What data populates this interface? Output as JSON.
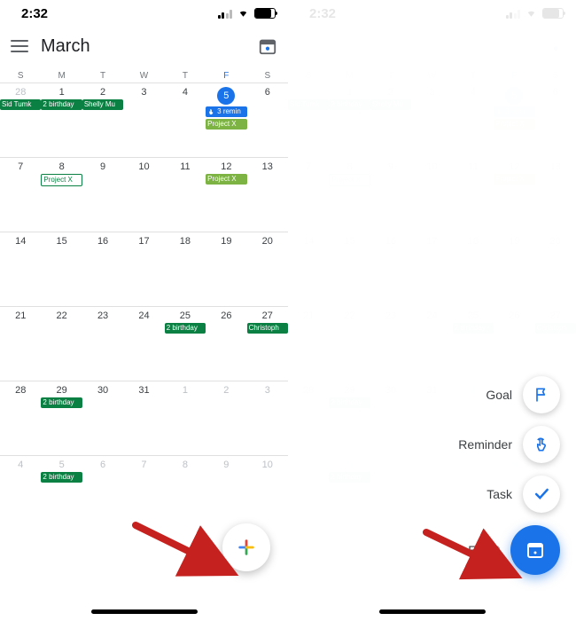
{
  "status": {
    "time": "2:32"
  },
  "header": {
    "month": "March"
  },
  "weekdays": [
    "S",
    "M",
    "T",
    "W",
    "T",
    "F",
    "S"
  ],
  "today_index": 5,
  "rows": [
    [
      {
        "n": "28",
        "dim": true,
        "chips": [
          {
            "t": "Sid Tumk",
            "s": "teal"
          }
        ]
      },
      {
        "n": "1",
        "chips": [
          {
            "t": "2 birthday",
            "s": "teal"
          }
        ]
      },
      {
        "n": "2",
        "chips": [
          {
            "t": "Shelly Mu",
            "s": "teal"
          }
        ]
      },
      {
        "n": "3"
      },
      {
        "n": "4"
      },
      {
        "n": "5",
        "today": true,
        "chips": [
          {
            "t": "3 remin",
            "s": "blue",
            "icon": true
          },
          {
            "t": "Project X",
            "s": "lime"
          }
        ]
      },
      {
        "n": "6"
      }
    ],
    [
      {
        "n": "7"
      },
      {
        "n": "8",
        "chips": [
          {
            "t": "Project X",
            "s": "outline"
          }
        ]
      },
      {
        "n": "9"
      },
      {
        "n": "10"
      },
      {
        "n": "11"
      },
      {
        "n": "12",
        "chips": [
          {
            "t": "Project X",
            "s": "lime"
          }
        ]
      },
      {
        "n": "13"
      }
    ],
    [
      {
        "n": "14"
      },
      {
        "n": "15"
      },
      {
        "n": "16"
      },
      {
        "n": "17"
      },
      {
        "n": "18"
      },
      {
        "n": "19"
      },
      {
        "n": "20"
      }
    ],
    [
      {
        "n": "21"
      },
      {
        "n": "22"
      },
      {
        "n": "23"
      },
      {
        "n": "24"
      },
      {
        "n": "25",
        "chips": [
          {
            "t": "2 birthday",
            "s": "teal"
          }
        ]
      },
      {
        "n": "26"
      },
      {
        "n": "27",
        "chips": [
          {
            "t": "Christoph",
            "s": "teal"
          }
        ]
      }
    ],
    [
      {
        "n": "28"
      },
      {
        "n": "29",
        "chips": [
          {
            "t": "2 birthday",
            "s": "teal"
          }
        ]
      },
      {
        "n": "30"
      },
      {
        "n": "31"
      },
      {
        "n": "1",
        "dim": true
      },
      {
        "n": "2",
        "dim": true
      },
      {
        "n": "3",
        "dim": true
      }
    ],
    [
      {
        "n": "4",
        "dim": true
      },
      {
        "n": "5",
        "dim": true,
        "chips": [
          {
            "t": "2 birthday",
            "s": "teal"
          }
        ]
      },
      {
        "n": "6",
        "dim": true
      },
      {
        "n": "7",
        "dim": true
      },
      {
        "n": "8",
        "dim": true
      },
      {
        "n": "9",
        "dim": true
      },
      {
        "n": "10",
        "dim": true
      }
    ]
  ],
  "fab_menu": [
    {
      "label": "Goal",
      "icon": "flag"
    },
    {
      "label": "Reminder",
      "icon": "tap"
    },
    {
      "label": "Task",
      "icon": "check"
    },
    {
      "label": "Event",
      "icon": "cal",
      "primary": true
    }
  ],
  "colors": {
    "blue": "#1a73e8",
    "teal": "#0b8043",
    "lime": "#7cb342",
    "arrow": "#c5221f"
  }
}
